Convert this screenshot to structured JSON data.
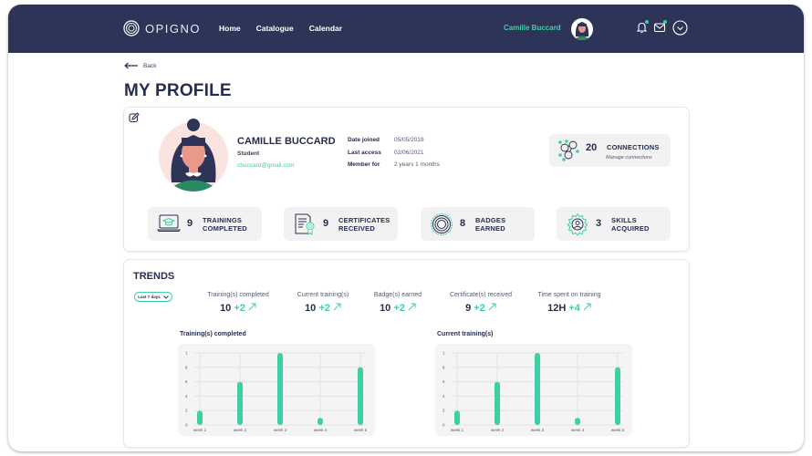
{
  "topbar": {
    "logo_text": "OPIGNO",
    "nav": [
      "Home",
      "Catalogue",
      "Calendar"
    ],
    "user_name": "Camille Buccard",
    "icons": [
      "bell-icon",
      "mail-icon",
      "chevron-down-circle-icon"
    ],
    "colors": {
      "bg": "#2d3457",
      "accent": "#3ecfa4"
    }
  },
  "back_label": "Back",
  "page_title": "MY PROFILE",
  "profile": {
    "name": "CAMILLE BUCCARD",
    "role": "Student",
    "email": "cbuccard@gmail.com",
    "meta": [
      {
        "label": "Date joined",
        "value": "05/05/2019"
      },
      {
        "label": "Last access",
        "value": "02/06/2021"
      },
      {
        "label": "Member for",
        "value": "2 years 1 months"
      }
    ],
    "connections": {
      "count": "20",
      "label": "CONNECTIONS",
      "link": "Manage connections"
    },
    "stats": [
      {
        "count": "9",
        "line1": "TRAININGS",
        "line2": "COMPLETED",
        "icon": "graduation-laptop-icon"
      },
      {
        "count": "9",
        "line1": "CERTIFICATES",
        "line2": "RECEIVED",
        "icon": "certificate-icon"
      },
      {
        "count": "8",
        "line1": "BADGES",
        "line2": "EARNED",
        "icon": "badge-icon"
      },
      {
        "count": "3",
        "line1": "SKILLS",
        "line2": "ACQUIRED",
        "icon": "skills-gear-icon"
      }
    ]
  },
  "trends": {
    "title": "TRENDS",
    "period": "Last 7 days",
    "kpis": [
      {
        "label": "Training(s) completed",
        "value": "10",
        "delta": "+2"
      },
      {
        "label": "Current training(s)",
        "value": "10",
        "delta": "+2"
      },
      {
        "label": "Badge(s) earned",
        "value": "10",
        "delta": "+2"
      },
      {
        "label": "Certificate(s) received",
        "value": "9",
        "delta": "+2"
      },
      {
        "label": "Time spent on training",
        "value": "12H",
        "delta": "+4"
      }
    ]
  },
  "chart_data": [
    {
      "type": "bar",
      "title": "Training(s) completed",
      "categories": [
        "week 1",
        "week 2",
        "week 3",
        "week 4",
        "week 5"
      ],
      "values": [
        2,
        6,
        10,
        1,
        8
      ],
      "yticks": [
        "0",
        "2",
        "4",
        "6",
        "8",
        "1"
      ],
      "ylim": [
        0,
        10
      ],
      "grid": true,
      "color": "#3ecfa4"
    },
    {
      "type": "bar",
      "title": "Current training(s)",
      "categories": [
        "week 1",
        "week 2",
        "week 3",
        "week 4",
        "week 5"
      ],
      "values": [
        2,
        6,
        10,
        1,
        8
      ],
      "yticks": [
        "0",
        "2",
        "4",
        "6",
        "8",
        "1"
      ],
      "ylim": [
        0,
        10
      ],
      "grid": true,
      "color": "#3ecfa4"
    }
  ]
}
